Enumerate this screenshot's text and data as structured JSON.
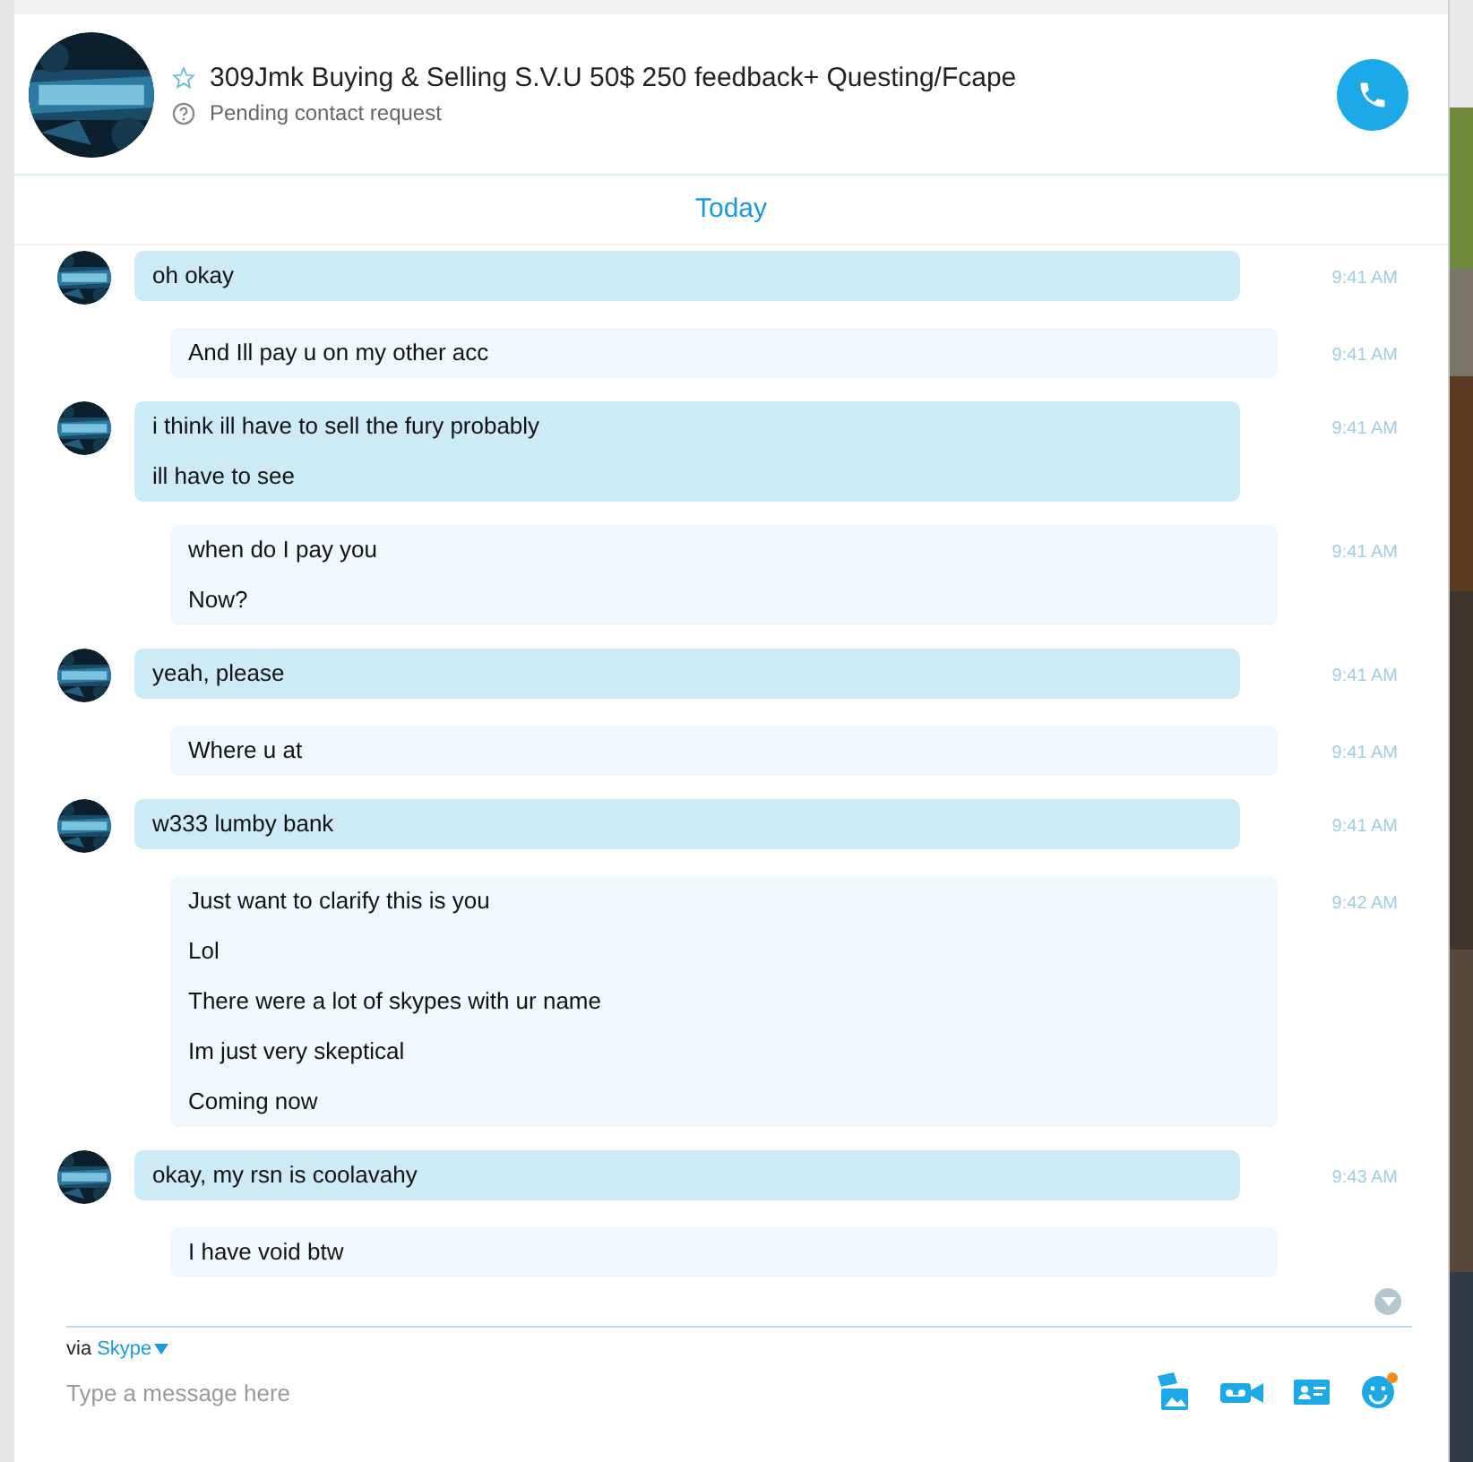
{
  "header": {
    "title": "309Jmk Buying & Selling S.V.U 50$ 250 feedback+ Questing/Fcape",
    "favorite": false,
    "status": "Pending contact request"
  },
  "day_divider": "Today",
  "messages": [
    {
      "kind": "incoming",
      "lines": [
        "oh okay"
      ],
      "time": "9:41 AM"
    },
    {
      "kind": "outgoing",
      "lines": [
        "And Ill pay u on my other acc"
      ],
      "time": "9:41 AM"
    },
    {
      "kind": "incoming",
      "lines": [
        "i think ill have to sell the fury probably",
        "ill have to see"
      ],
      "time": "9:41 AM"
    },
    {
      "kind": "outgoing",
      "lines": [
        "when do I pay you",
        "Now?"
      ],
      "time": "9:41 AM"
    },
    {
      "kind": "incoming",
      "lines": [
        "yeah, please"
      ],
      "time": "9:41 AM"
    },
    {
      "kind": "outgoing",
      "lines": [
        "Where u at"
      ],
      "time": "9:41 AM"
    },
    {
      "kind": "incoming",
      "lines": [
        "w333 lumby bank"
      ],
      "time": "9:41 AM"
    },
    {
      "kind": "outgoing",
      "lines": [
        "Just want to clarify this is you",
        "Lol",
        "There were a lot of skypes with ur name",
        "Im just very skeptical",
        "Coming now"
      ],
      "time": "9:42 AM"
    },
    {
      "kind": "incoming",
      "lines": [
        "okay, my rsn is coolavahy"
      ],
      "time": "9:43 AM"
    },
    {
      "kind": "outgoing",
      "lines": [
        "I have void btw"
      ]
    }
  ],
  "compose": {
    "via_label": "via",
    "service": "Skype",
    "placeholder": "Type a message here"
  }
}
